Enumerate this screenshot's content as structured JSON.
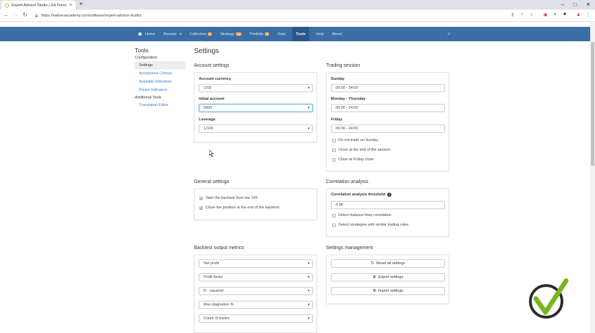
{
  "browser": {
    "tab_title": "Expert Advisor Studio | EA Forex",
    "tab_close": "×",
    "new_tab": "+",
    "url": "https://eaforexacademy.com/software/expert-advisor-studio/",
    "window_minimize": "–",
    "window_maximize": "□",
    "window_close": "✕"
  },
  "nav": {
    "items": [
      {
        "label": "Home"
      },
      {
        "label": "Reactor",
        "suffix": "▾"
      },
      {
        "label": "Collection",
        "badge": "0"
      },
      {
        "label": "Strategy",
        "badge": "10"
      },
      {
        "label": "Portfolio",
        "badge": "0"
      },
      {
        "label": "Data"
      },
      {
        "label": "Tools",
        "active": true
      },
      {
        "label": "Help"
      },
      {
        "label": "About"
      }
    ]
  },
  "sidebar": {
    "title": "Tools",
    "group1": "Configuration",
    "items1": [
      "Settings",
      "Acceptance Criteria",
      "Available Indicators",
      "Preset Indicators"
    ],
    "group2": "Additional Tools",
    "items2": [
      "Translation Editor"
    ]
  },
  "page_title": "Settings",
  "account": {
    "title": "Account settings",
    "currency_label": "Account currency",
    "currency_value": "USD",
    "initial_label": "Initial account",
    "initial_value": "5000",
    "leverage_label": "Leverage",
    "leverage_value": "1/100"
  },
  "trading": {
    "title": "Trading session",
    "sunday_label": "Sunday",
    "sunday_value": "00:00 - 24:00",
    "monthu_label": "Monday - Thursday",
    "monthu_value": "00:00 - 24:00",
    "friday_label": "Friday",
    "friday_value": "00:00 - 24:00",
    "check1": "Do not trade on Sunday",
    "check2": "Close at the end of the session",
    "check3": "Close at Friday close"
  },
  "general": {
    "title": "General settings",
    "check1": "Start the backtest from bar 100",
    "check2": "Close the position at the end of the backtest"
  },
  "correlation": {
    "title": "Correlation analysis",
    "threshold_label": "Correlation analysis threshold",
    "threshold_value": "0.98",
    "check1": "Detect balance lines correlation",
    "check2": "Detect strategies with similar trading rules"
  },
  "backtest": {
    "title": "Backtest output metrics",
    "metrics": [
      "Net profit",
      "Profit factor",
      "R - squared",
      "Max stagnation %",
      "Count of trades"
    ]
  },
  "management": {
    "title": "Settings management",
    "reset": "Reset all settings",
    "export": "Export settings",
    "import": "Import settings"
  }
}
